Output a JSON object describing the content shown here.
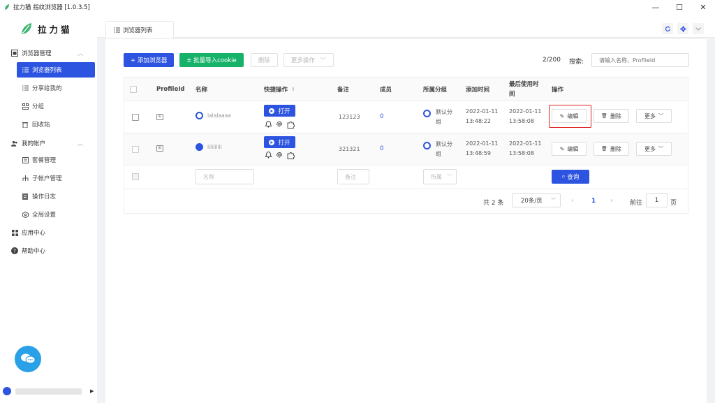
{
  "window": {
    "title": "拉力猫 指纹浏览器 [1.0.3.5]",
    "controls": {
      "minimize": "—",
      "maximize": "☐",
      "close": "✕"
    }
  },
  "sidebar": {
    "logo_text": "拉力猫",
    "groups": [
      {
        "label": "浏览器管理",
        "items": [
          "浏览器列表",
          "分享给我的",
          "分组",
          "回收站"
        ]
      },
      {
        "label": "我的帐户",
        "items": [
          "套餐管理",
          "子帐户管理",
          "操作日志",
          "全局设置"
        ]
      },
      {
        "label": "应用中心"
      },
      {
        "label": "帮助中心"
      }
    ],
    "active_item": "浏览器列表"
  },
  "tabs": [
    {
      "label": "浏览器列表"
    }
  ],
  "toolbar": {
    "add_label": "+ 添加浏览器",
    "import_label": "± 批量导入cookie",
    "delete_label": "删除",
    "more_label": "更多操作",
    "count": "2/200",
    "search_label": "搜索:",
    "search_placeholder": "请输入名称、ProfileId"
  },
  "table": {
    "headers": [
      "ProfileId",
      "名称",
      "快捷操作",
      "备注",
      "成员",
      "所属分组",
      "添加时间",
      "最后使用时间",
      "操作"
    ],
    "open_label": "打开",
    "edit_label": "编辑",
    "delete_label": "删除",
    "more_label": "更多",
    "rows": [
      {
        "name": "lalalaaaa",
        "remark": "123123",
        "members": "0",
        "group": "默认分组",
        "add_date": "2022-01-11",
        "add_time": "13:48:22",
        "last_date": "2022-01-11",
        "last_time": "13:58:08"
      },
      {
        "name": "lilililili",
        "remark": "321321",
        "members": "0",
        "group": "默认分组",
        "add_date": "2022-01-11",
        "add_time": "13:48:59",
        "last_date": "2022-01-11",
        "last_time": "13:58:08"
      }
    ],
    "filter": {
      "name_placeholder": "名称",
      "remark_placeholder": "备注",
      "group_placeholder": "所属",
      "query_label": "查询"
    }
  },
  "pagination": {
    "total": "共 2 条",
    "page_size": "20条/页",
    "current": "1",
    "goto_label": "前往",
    "goto_value": "1",
    "page_unit": "页"
  },
  "colors": {
    "primary": "#2d54e0",
    "green": "#17b26a",
    "highlight": "#e02020"
  }
}
